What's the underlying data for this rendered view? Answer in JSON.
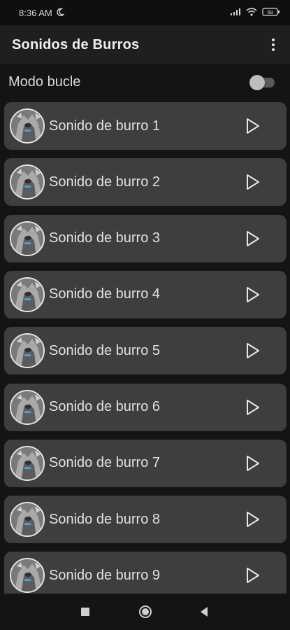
{
  "status_bar": {
    "time": "8:36 AM",
    "icons": [
      "moon-icon",
      "signal-icon",
      "wifi-icon",
      "battery-icon"
    ],
    "battery_level": "58"
  },
  "app_bar": {
    "title": "Sonidos de Burros",
    "menu_icon": "more-vert-icon"
  },
  "loop": {
    "label": "Modo bucle",
    "enabled": false
  },
  "sounds": [
    {
      "label": "Sonido de burro 1"
    },
    {
      "label": "Sonido de burro 2"
    },
    {
      "label": "Sonido de burro 3"
    },
    {
      "label": "Sonido de burro 4"
    },
    {
      "label": "Sonido de burro 5"
    },
    {
      "label": "Sonido de burro 6"
    },
    {
      "label": "Sonido de burro 7"
    },
    {
      "label": "Sonido de burro 8"
    },
    {
      "label": "Sonido de burro 9"
    }
  ],
  "nav_bar": {
    "buttons": [
      "recents-square-icon",
      "home-circle-icon",
      "back-triangle-icon"
    ]
  },
  "colors": {
    "background": "#141414",
    "app_bar": "#1f1f1f",
    "item_bg": "#3e3e3e",
    "text": "#e2e2e2"
  }
}
